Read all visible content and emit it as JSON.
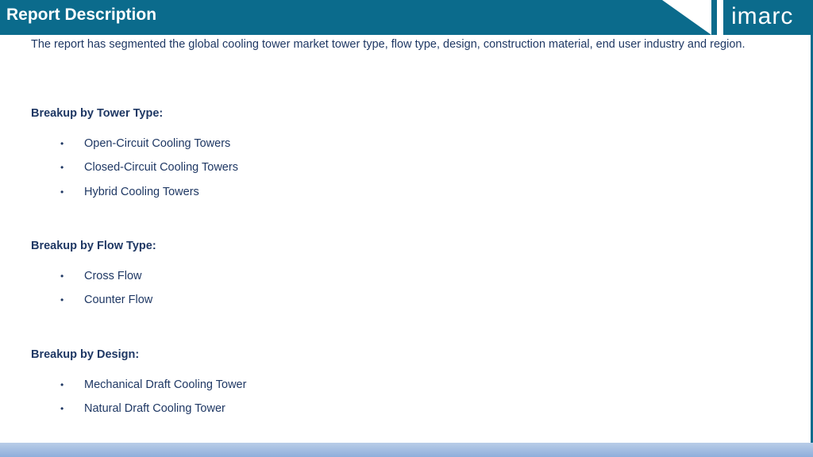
{
  "header": {
    "title": "Report Description",
    "logo": "imarc"
  },
  "intro": "The report has segmented the global cooling tower market tower type, flow type, design, construction material, end user industry and region.",
  "sections": [
    {
      "heading": "Breakup by Tower Type:",
      "items": [
        "Open-Circuit Cooling Towers",
        "Closed-Circuit Cooling Towers",
        "Hybrid Cooling Towers"
      ]
    },
    {
      "heading": "Breakup by Flow Type:",
      "items": [
        "Cross Flow",
        "Counter Flow"
      ]
    },
    {
      "heading": "Breakup by Design:",
      "items": [
        "Mechanical Draft Cooling Tower",
        "Natural Draft Cooling Tower"
      ]
    }
  ],
  "bullet_glyph": "•",
  "colors": {
    "header": "#0b6b8c",
    "text": "#1f3864",
    "footer": "#8faedb"
  }
}
